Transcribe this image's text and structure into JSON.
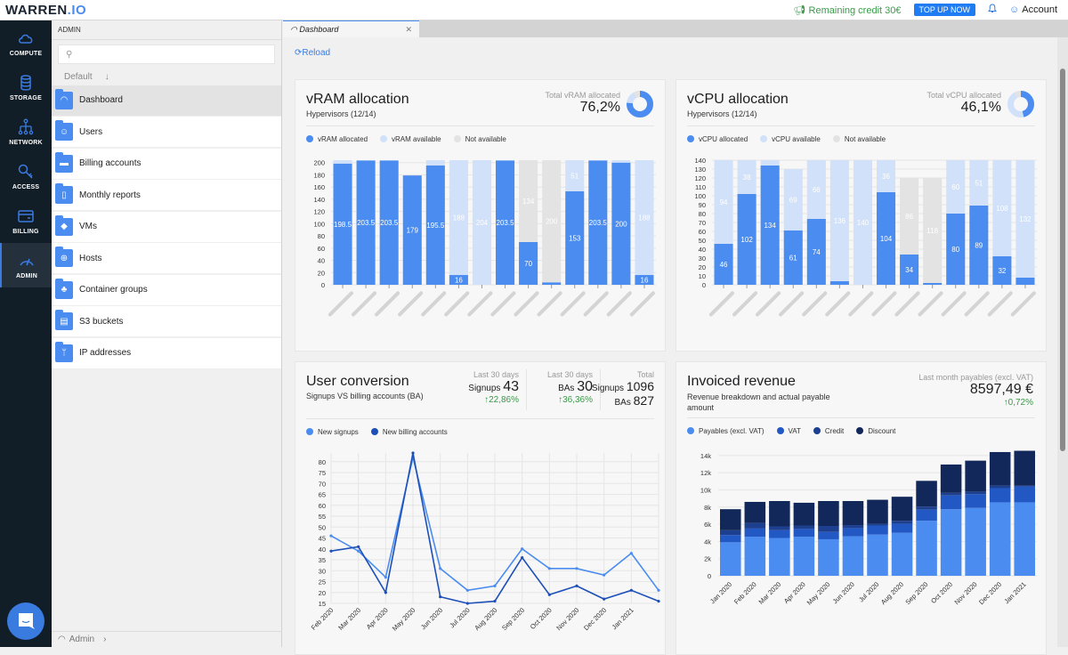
{
  "topbar": {
    "logo_main": "WARREN",
    "logo_suffix": ".IO",
    "credit": "Remaining credit 30€",
    "topup": "TOP UP NOW",
    "account": "Account"
  },
  "rail": [
    {
      "label": "COMPUTE",
      "icon": "cloud-icon"
    },
    {
      "label": "STORAGE",
      "icon": "database-icon"
    },
    {
      "label": "NETWORK",
      "icon": "network-icon"
    },
    {
      "label": "ACCESS",
      "icon": "key-icon"
    },
    {
      "label": "BILLING",
      "icon": "credit-card-icon"
    },
    {
      "label": "ADMIN",
      "icon": "gauge-icon",
      "active": true
    }
  ],
  "panel": {
    "heading": "ADMIN",
    "search_placeholder": "",
    "sort_label": "Default",
    "items": [
      {
        "label": "Dashboard",
        "icon": "gauge-icon",
        "glyph": "◠"
      },
      {
        "label": "Users",
        "icon": "user-icon",
        "glyph": "☺"
      },
      {
        "label": "Billing accounts",
        "icon": "credit-card-icon",
        "glyph": "▬"
      },
      {
        "label": "Monthly reports",
        "icon": "document-icon",
        "glyph": "▯"
      },
      {
        "label": "VMs",
        "icon": "cube-icon",
        "glyph": "◆"
      },
      {
        "label": "Hosts",
        "icon": "globe-icon",
        "glyph": "⊕"
      },
      {
        "label": "Container groups",
        "icon": "containers-icon",
        "glyph": "♣"
      },
      {
        "label": "S3 buckets",
        "icon": "database-icon",
        "glyph": "▤"
      },
      {
        "label": "IP addresses",
        "icon": "branch-icon",
        "glyph": "ᛘ"
      }
    ],
    "footer": "Admin"
  },
  "tab": {
    "label": "Dashboard"
  },
  "reload": "Reload",
  "colors": {
    "allocated": "#4a8cf0",
    "available": "#d1e1f9",
    "not_available": "#e3e3e3",
    "signups": "#4a8cf0",
    "billing": "#1d4fb8",
    "payables": "#4a8cf0",
    "vat": "#2258c4",
    "credit": "#1d3f8f",
    "discount": "#12285a"
  },
  "vram": {
    "title": "vRAM allocation",
    "subtitle": "Hypervisors (12/14)",
    "kpi_label": "Total vRAM allocated",
    "kpi_value": "76,2%",
    "legend": [
      "vRAM allocated",
      "vRAM available",
      "Not available"
    ]
  },
  "vcpu": {
    "title": "vCPU allocation",
    "subtitle": "Hypervisors (12/14)",
    "kpi_label": "Total vCPU allocated",
    "kpi_value": "46,1%",
    "legend": [
      "vCPU allocated",
      "vCPU available",
      "Not available"
    ]
  },
  "conversion": {
    "title": "User conversion",
    "subtitle": "Signups VS billing accounts (BA)",
    "col1": {
      "label": "Last 30 days",
      "name": "Signups",
      "value": "43",
      "change": "↑22,86%"
    },
    "col2": {
      "label": "Last 30 days",
      "name": "BAs",
      "value": "30",
      "change": "↑36,36%"
    },
    "col3": {
      "label": "Total",
      "name1": "Signups",
      "value1": "1096",
      "name2": "BAs",
      "value2": "827"
    },
    "legend": [
      "New signups",
      "New billing accounts"
    ]
  },
  "revenue": {
    "title": "Invoiced revenue",
    "subtitle": "Revenue breakdown and actual payable amount",
    "kpi_label": "Last month payables (excl. VAT)",
    "kpi_value": "8597,49 €",
    "kpi_change": "↑0,72%",
    "legend": [
      "Payables (excl. VAT)",
      "VAT",
      "Credit",
      "Discount"
    ]
  },
  "chart_data": [
    {
      "type": "bar",
      "title": "vRAM allocation",
      "stacked": true,
      "categories": [
        "host-1",
        "host-2",
        "host-3",
        "host-4",
        "host-5",
        "host-6",
        "host-7",
        "host-8",
        "host-9",
        "host-10",
        "host-11",
        "host-12",
        "host-13",
        "host-14"
      ],
      "categories_redacted": true,
      "series": [
        {
          "name": "vRAM allocated",
          "values": [
            198.5,
            203.5,
            203.5,
            179,
            195.5,
            16,
            0,
            203.5,
            70,
            4,
            153,
            203.5,
            200,
            16
          ]
        },
        {
          "name": "vRAM available",
          "values": [
            5.5,
            0,
            0,
            0,
            8.5,
            188,
            204,
            0,
            0,
            0,
            51,
            0,
            4,
            188
          ]
        },
        {
          "name": "Not available",
          "values": [
            0,
            0,
            0,
            0,
            0,
            0,
            0,
            0,
            134,
            200,
            0,
            0,
            0,
            0
          ]
        }
      ],
      "data_labels": [
        "198.5",
        "203.5",
        "203.5",
        "179",
        "195.5",
        "16|188",
        "204",
        "203.5",
        "70|134",
        "200",
        "153|51",
        "203.5",
        "200",
        "16|188"
      ],
      "ylim": [
        0,
        204
      ],
      "yticks": [
        0,
        20,
        40,
        60,
        80,
        100,
        120,
        140,
        160,
        180,
        200
      ],
      "donut": {
        "allocated_pct": 76.2
      }
    },
    {
      "type": "bar",
      "title": "vCPU allocation",
      "stacked": true,
      "categories": [
        "host-1",
        "host-2",
        "host-3",
        "host-4",
        "host-5",
        "host-6",
        "host-7",
        "host-8",
        "host-9",
        "host-10",
        "host-11",
        "host-12",
        "host-13",
        "host-14"
      ],
      "categories_redacted": true,
      "series": [
        {
          "name": "vCPU allocated",
          "values": [
            46,
            102,
            134,
            61,
            74,
            4,
            0,
            104,
            34,
            2,
            80,
            89,
            32,
            8
          ]
        },
        {
          "name": "vCPU available",
          "values": [
            94,
            38,
            6,
            69,
            66,
            136,
            140,
            36,
            0,
            0,
            60,
            51,
            108,
            132
          ]
        },
        {
          "name": "Not available",
          "values": [
            0,
            0,
            0,
            0,
            0,
            0,
            0,
            0,
            86,
            118,
            0,
            0,
            0,
            0
          ]
        }
      ],
      "ylim": [
        0,
        140
      ],
      "yticks": [
        0,
        10,
        20,
        30,
        40,
        50,
        60,
        70,
        80,
        90,
        100,
        110,
        120,
        130,
        140
      ],
      "donut": {
        "allocated_pct": 46.1
      }
    },
    {
      "type": "line",
      "title": "User conversion",
      "x": [
        "Feb 2020",
        "Mar 2020",
        "Apr 2020",
        "May 2020",
        "Jun 2020",
        "Jul 2020",
        "Aug 2020",
        "Sep 2020",
        "Oct 2020",
        "Nov 2020",
        "Dec 2020",
        "Jan 2021",
        ""
      ],
      "series": [
        {
          "name": "New signups",
          "values": [
            46,
            39,
            27,
            82,
            31,
            21,
            23,
            40,
            31,
            31,
            28,
            38,
            21
          ]
        },
        {
          "name": "New billing accounts",
          "values": [
            39,
            41,
            20,
            84,
            18,
            15,
            16,
            36,
            19,
            23,
            17,
            21,
            16
          ]
        }
      ],
      "ylim": [
        15,
        84
      ],
      "yticks": [
        15,
        20,
        25,
        30,
        35,
        40,
        45,
        50,
        55,
        60,
        65,
        70,
        75,
        80
      ],
      "grid": true
    },
    {
      "type": "bar",
      "title": "Invoiced revenue",
      "stacked": true,
      "categories": [
        "Jan 2020",
        "Feb 2020",
        "Mar 2020",
        "Apr 2020",
        "May 2020",
        "Jun 2020",
        "Jul 2020",
        "Aug 2020",
        "Sep 2020",
        "Oct 2020",
        "Nov 2020",
        "Dec 2020",
        "Jan 2021"
      ],
      "series": [
        {
          "name": "Payables (excl. VAT)",
          "values": [
            3900,
            4550,
            4400,
            4550,
            4250,
            4600,
            4800,
            5000,
            6400,
            7750,
            7900,
            8550,
            8550
          ]
        },
        {
          "name": "VAT",
          "values": [
            850,
            950,
            900,
            900,
            850,
            950,
            1050,
            1050,
            1300,
            1600,
            1600,
            1650,
            1850
          ]
        },
        {
          "name": "Credit",
          "values": [
            550,
            650,
            450,
            400,
            700,
            350,
            200,
            350,
            350,
            300,
            300,
            300,
            100
          ]
        },
        {
          "name": "Discount",
          "values": [
            2450,
            2450,
            2950,
            2650,
            2900,
            2800,
            2800,
            2800,
            3000,
            3300,
            3600,
            3900,
            4050
          ]
        }
      ],
      "ylim": [
        0,
        14500
      ],
      "yticks": [
        "0",
        "2k",
        "4k",
        "6k",
        "8k",
        "10k",
        "12k",
        "14k"
      ],
      "grid": true
    }
  ]
}
